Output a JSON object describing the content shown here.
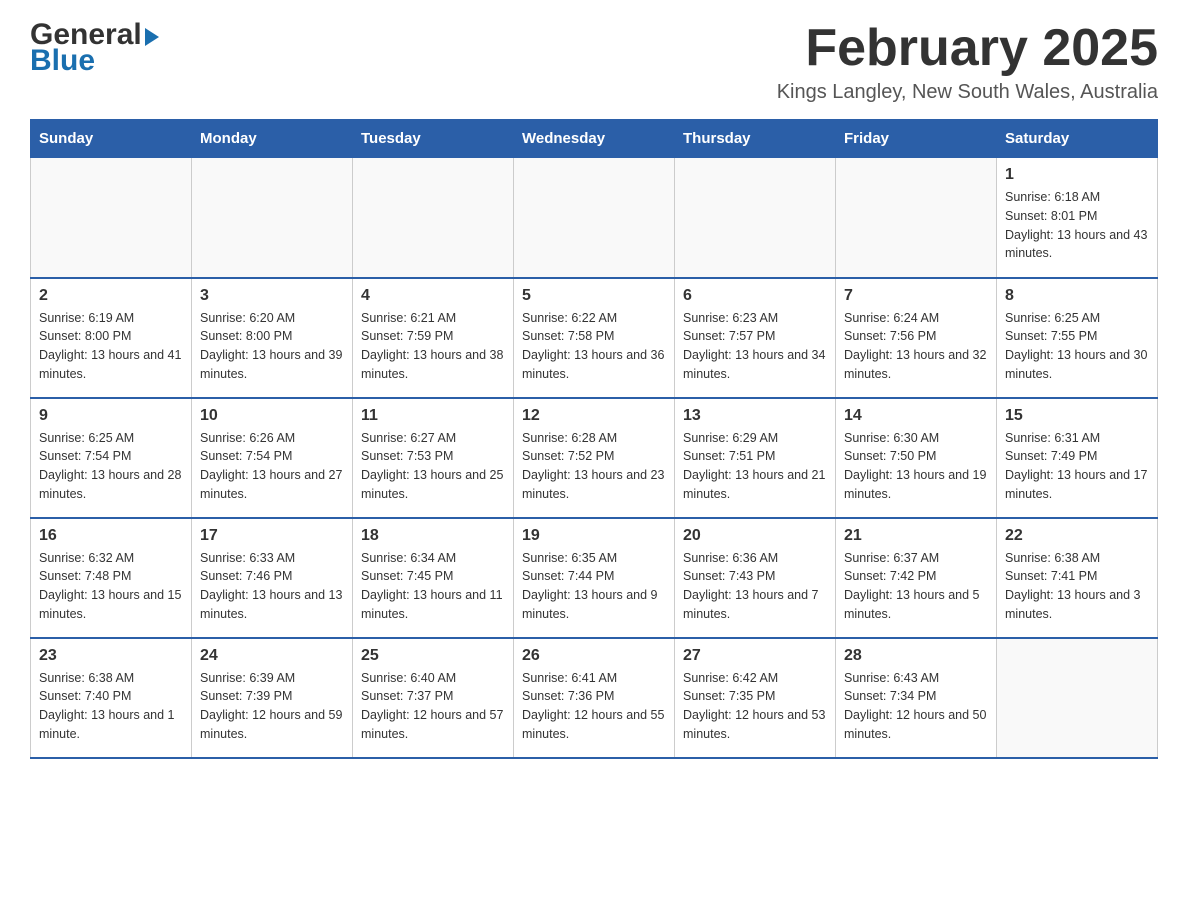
{
  "header": {
    "logo_general": "General",
    "logo_blue": "Blue",
    "title": "February 2025",
    "subtitle": "Kings Langley, New South Wales, Australia"
  },
  "calendar": {
    "days_of_week": [
      "Sunday",
      "Monday",
      "Tuesday",
      "Wednesday",
      "Thursday",
      "Friday",
      "Saturday"
    ],
    "weeks": [
      [
        {
          "day": "",
          "info": ""
        },
        {
          "day": "",
          "info": ""
        },
        {
          "day": "",
          "info": ""
        },
        {
          "day": "",
          "info": ""
        },
        {
          "day": "",
          "info": ""
        },
        {
          "day": "",
          "info": ""
        },
        {
          "day": "1",
          "info": "Sunrise: 6:18 AM\nSunset: 8:01 PM\nDaylight: 13 hours and 43 minutes."
        }
      ],
      [
        {
          "day": "2",
          "info": "Sunrise: 6:19 AM\nSunset: 8:00 PM\nDaylight: 13 hours and 41 minutes."
        },
        {
          "day": "3",
          "info": "Sunrise: 6:20 AM\nSunset: 8:00 PM\nDaylight: 13 hours and 39 minutes."
        },
        {
          "day": "4",
          "info": "Sunrise: 6:21 AM\nSunset: 7:59 PM\nDaylight: 13 hours and 38 minutes."
        },
        {
          "day": "5",
          "info": "Sunrise: 6:22 AM\nSunset: 7:58 PM\nDaylight: 13 hours and 36 minutes."
        },
        {
          "day": "6",
          "info": "Sunrise: 6:23 AM\nSunset: 7:57 PM\nDaylight: 13 hours and 34 minutes."
        },
        {
          "day": "7",
          "info": "Sunrise: 6:24 AM\nSunset: 7:56 PM\nDaylight: 13 hours and 32 minutes."
        },
        {
          "day": "8",
          "info": "Sunrise: 6:25 AM\nSunset: 7:55 PM\nDaylight: 13 hours and 30 minutes."
        }
      ],
      [
        {
          "day": "9",
          "info": "Sunrise: 6:25 AM\nSunset: 7:54 PM\nDaylight: 13 hours and 28 minutes."
        },
        {
          "day": "10",
          "info": "Sunrise: 6:26 AM\nSunset: 7:54 PM\nDaylight: 13 hours and 27 minutes."
        },
        {
          "day": "11",
          "info": "Sunrise: 6:27 AM\nSunset: 7:53 PM\nDaylight: 13 hours and 25 minutes."
        },
        {
          "day": "12",
          "info": "Sunrise: 6:28 AM\nSunset: 7:52 PM\nDaylight: 13 hours and 23 minutes."
        },
        {
          "day": "13",
          "info": "Sunrise: 6:29 AM\nSunset: 7:51 PM\nDaylight: 13 hours and 21 minutes."
        },
        {
          "day": "14",
          "info": "Sunrise: 6:30 AM\nSunset: 7:50 PM\nDaylight: 13 hours and 19 minutes."
        },
        {
          "day": "15",
          "info": "Sunrise: 6:31 AM\nSunset: 7:49 PM\nDaylight: 13 hours and 17 minutes."
        }
      ],
      [
        {
          "day": "16",
          "info": "Sunrise: 6:32 AM\nSunset: 7:48 PM\nDaylight: 13 hours and 15 minutes."
        },
        {
          "day": "17",
          "info": "Sunrise: 6:33 AM\nSunset: 7:46 PM\nDaylight: 13 hours and 13 minutes."
        },
        {
          "day": "18",
          "info": "Sunrise: 6:34 AM\nSunset: 7:45 PM\nDaylight: 13 hours and 11 minutes."
        },
        {
          "day": "19",
          "info": "Sunrise: 6:35 AM\nSunset: 7:44 PM\nDaylight: 13 hours and 9 minutes."
        },
        {
          "day": "20",
          "info": "Sunrise: 6:36 AM\nSunset: 7:43 PM\nDaylight: 13 hours and 7 minutes."
        },
        {
          "day": "21",
          "info": "Sunrise: 6:37 AM\nSunset: 7:42 PM\nDaylight: 13 hours and 5 minutes."
        },
        {
          "day": "22",
          "info": "Sunrise: 6:38 AM\nSunset: 7:41 PM\nDaylight: 13 hours and 3 minutes."
        }
      ],
      [
        {
          "day": "23",
          "info": "Sunrise: 6:38 AM\nSunset: 7:40 PM\nDaylight: 13 hours and 1 minute."
        },
        {
          "day": "24",
          "info": "Sunrise: 6:39 AM\nSunset: 7:39 PM\nDaylight: 12 hours and 59 minutes."
        },
        {
          "day": "25",
          "info": "Sunrise: 6:40 AM\nSunset: 7:37 PM\nDaylight: 12 hours and 57 minutes."
        },
        {
          "day": "26",
          "info": "Sunrise: 6:41 AM\nSunset: 7:36 PM\nDaylight: 12 hours and 55 minutes."
        },
        {
          "day": "27",
          "info": "Sunrise: 6:42 AM\nSunset: 7:35 PM\nDaylight: 12 hours and 53 minutes."
        },
        {
          "day": "28",
          "info": "Sunrise: 6:43 AM\nSunset: 7:34 PM\nDaylight: 12 hours and 50 minutes."
        },
        {
          "day": "",
          "info": ""
        }
      ]
    ]
  }
}
